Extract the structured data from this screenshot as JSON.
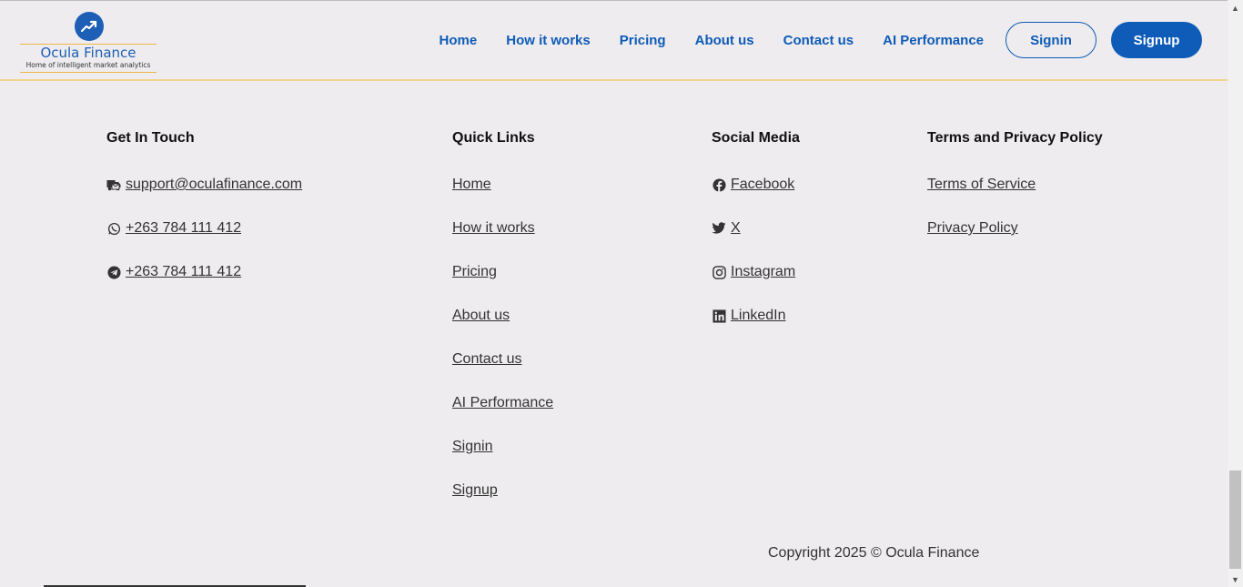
{
  "brand": {
    "name": "Ocula Finance",
    "tagline": "Home of intelligent market analytics"
  },
  "nav": {
    "links": [
      "Home",
      "How it works",
      "Pricing",
      "About us",
      "Contact us",
      "AI Performance"
    ],
    "signin": "Signin",
    "signup": "Signup"
  },
  "footer": {
    "get_in_touch": {
      "heading": "Get In Touch",
      "email": "support@oculafinance.com",
      "whatsapp": "+263 784 111 412",
      "telegram": "+263 784 111 412"
    },
    "quick_links": {
      "heading": "Quick Links",
      "items": [
        "Home",
        "How it works",
        "Pricing",
        "About us",
        "Contact us",
        "AI Performance",
        "Signin",
        "Signup"
      ]
    },
    "social": {
      "heading": "Social Media",
      "items": [
        "Facebook",
        "X",
        "Instagram",
        "LinkedIn"
      ]
    },
    "terms": {
      "heading": "Terms and Privacy Policy",
      "items": [
        "Terms of Service",
        "Privacy Policy"
      ]
    },
    "copyright": "Copyright 2025 © Ocula Finance"
  },
  "colors": {
    "brand_blue": "#0e5bb8",
    "background": "#eeecee",
    "accent_rule": "#f2d58a"
  },
  "icons": [
    "trend-up-icon",
    "shipping-mail-icon",
    "whatsapp-icon",
    "telegram-icon",
    "facebook-icon",
    "twitter-icon",
    "instagram-icon",
    "linkedin-icon"
  ]
}
